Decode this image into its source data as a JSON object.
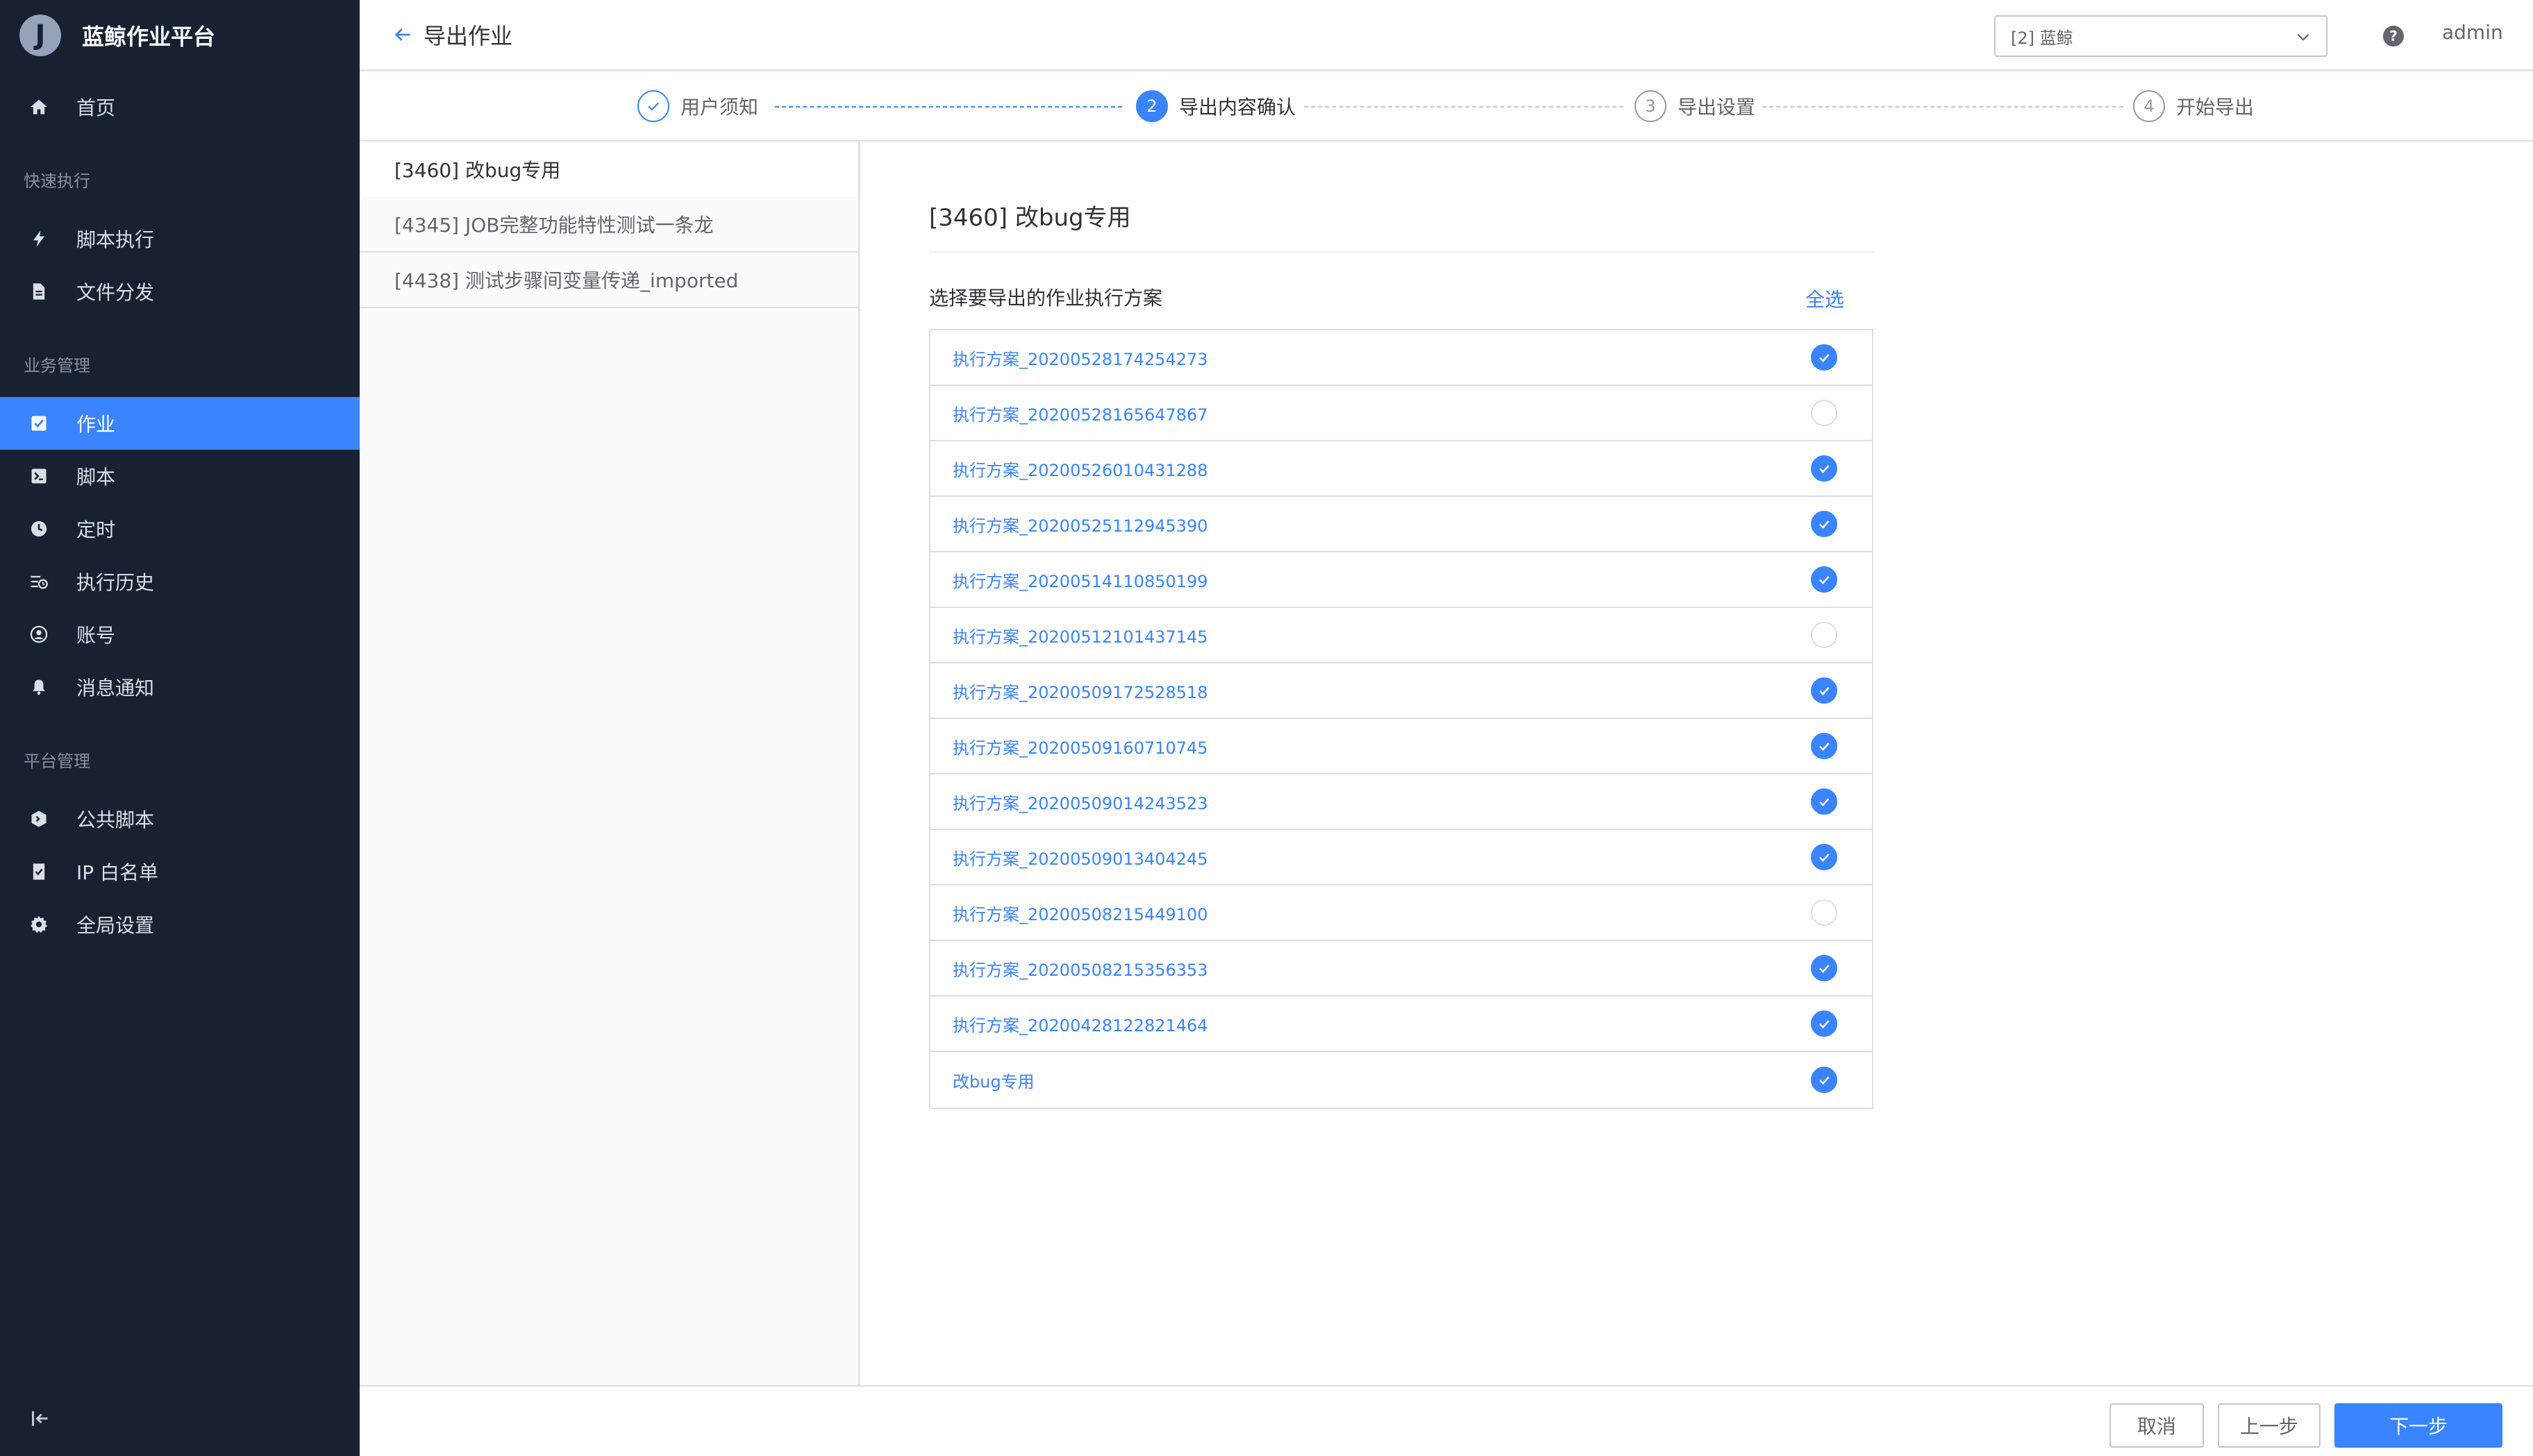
{
  "brand": {
    "logo_letter": "J",
    "name": "蓝鲸作业平台"
  },
  "sidebar": {
    "home": "首页",
    "groups": [
      {
        "title": "快速执行",
        "items": [
          {
            "label": "脚本执行",
            "icon": "lightning-icon"
          },
          {
            "label": "文件分发",
            "icon": "file-icon"
          }
        ]
      },
      {
        "title": "业务管理",
        "items": [
          {
            "label": "作业",
            "icon": "job-icon",
            "active": true
          },
          {
            "label": "脚本",
            "icon": "terminal-icon"
          },
          {
            "label": "定时",
            "icon": "clock-icon"
          },
          {
            "label": "执行历史",
            "icon": "history-icon"
          },
          {
            "label": "账号",
            "icon": "account-icon"
          },
          {
            "label": "消息通知",
            "icon": "bell-icon"
          }
        ]
      },
      {
        "title": "平台管理",
        "items": [
          {
            "label": "公共脚本",
            "icon": "public-script-icon"
          },
          {
            "label": "IP 白名单",
            "icon": "whitelist-icon"
          },
          {
            "label": "全局设置",
            "icon": "gear-icon"
          }
        ]
      }
    ]
  },
  "header": {
    "title": "导出作业",
    "business": "[2] 蓝鲸",
    "help": "?",
    "user": "admin"
  },
  "steps": [
    {
      "label": "用户须知",
      "number": "",
      "state": "done"
    },
    {
      "label": "导出内容确认",
      "number": "2",
      "state": "active"
    },
    {
      "label": "导出设置",
      "number": "3",
      "state": "pending"
    },
    {
      "label": "开始导出",
      "number": "4",
      "state": "pending"
    }
  ],
  "jobs": [
    {
      "label": "[3460] 改bug专用",
      "active": true
    },
    {
      "label": "[4345] JOB完整功能特性测试一条龙",
      "active": false
    },
    {
      "label": "[4438] 测试步骤间变量传递_imported",
      "active": false
    }
  ],
  "main": {
    "title": "[3460] 改bug专用",
    "plan_heading": "选择要导出的作业执行方案",
    "select_all": "全选",
    "plans": [
      {
        "name": "执行方案_20200528174254273",
        "checked": true
      },
      {
        "name": "执行方案_20200528165647867",
        "checked": false
      },
      {
        "name": "执行方案_20200526010431288",
        "checked": true
      },
      {
        "name": "执行方案_20200525112945390",
        "checked": true
      },
      {
        "name": "执行方案_20200514110850199",
        "checked": true
      },
      {
        "name": "执行方案_20200512101437145",
        "checked": false
      },
      {
        "name": "执行方案_20200509172528518",
        "checked": true
      },
      {
        "name": "执行方案_20200509160710745",
        "checked": true
      },
      {
        "name": "执行方案_20200509014243523",
        "checked": true
      },
      {
        "name": "执行方案_20200509013404245",
        "checked": true
      },
      {
        "name": "执行方案_20200508215449100",
        "checked": false
      },
      {
        "name": "执行方案_20200508215356353",
        "checked": true
      },
      {
        "name": "执行方案_20200428122821464",
        "checked": true
      },
      {
        "name": "改bug专用",
        "checked": true
      }
    ]
  },
  "footer": {
    "cancel": "取消",
    "prev": "上一步",
    "next": "下一步"
  },
  "colors": {
    "accent": "#3a84ff",
    "sidebar_bg": "#182132"
  }
}
